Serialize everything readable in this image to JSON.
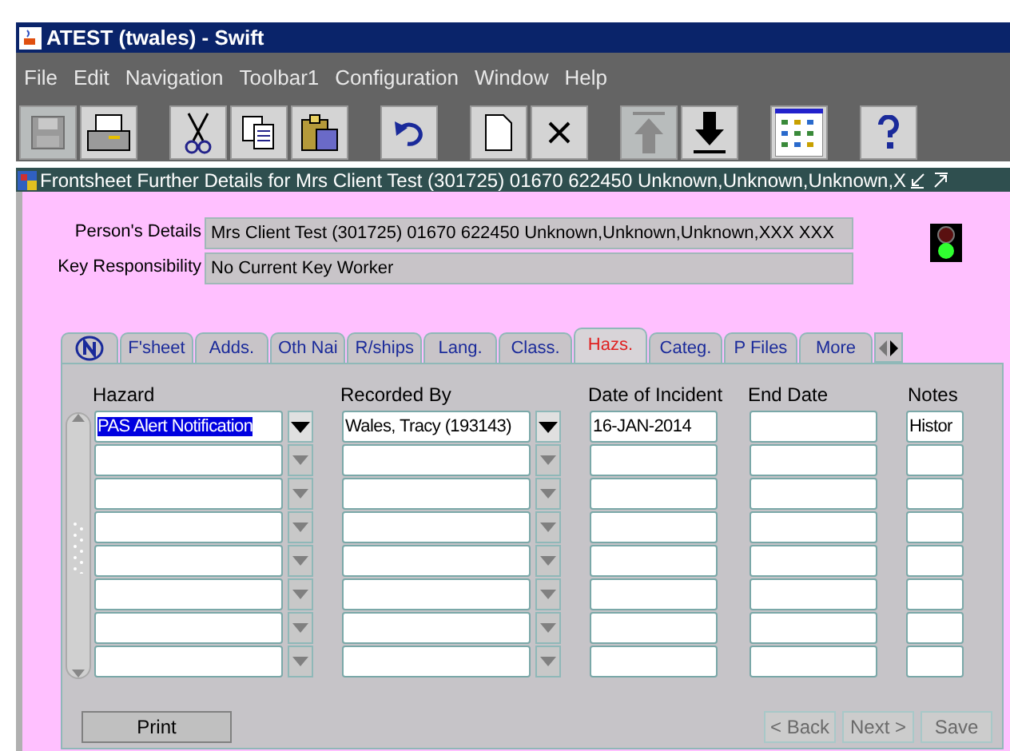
{
  "window": {
    "title": "ATEST (twales) - Swift"
  },
  "menu": [
    {
      "label": "File"
    },
    {
      "label": "Edit"
    },
    {
      "label": "Navigation"
    },
    {
      "label": "Toolbar1"
    },
    {
      "label": "Configuration"
    },
    {
      "label": "Window"
    },
    {
      "label": "Help"
    }
  ],
  "toolbar": [
    {
      "kind": "save",
      "disabled": true
    },
    {
      "kind": "print",
      "disabled": false
    },
    {
      "kind": "gap"
    },
    {
      "kind": "cut",
      "disabled": false
    },
    {
      "kind": "copy",
      "disabled": false
    },
    {
      "kind": "paste",
      "disabled": false
    },
    {
      "kind": "gap"
    },
    {
      "kind": "undo",
      "disabled": false
    },
    {
      "kind": "gap"
    },
    {
      "kind": "new",
      "disabled": false
    },
    {
      "kind": "delete",
      "disabled": false
    },
    {
      "kind": "gap"
    },
    {
      "kind": "up",
      "disabled": true
    },
    {
      "kind": "down",
      "disabled": false
    },
    {
      "kind": "gap"
    },
    {
      "kind": "grid",
      "disabled": false
    },
    {
      "kind": "gap"
    },
    {
      "kind": "help",
      "disabled": false
    }
  ],
  "form": {
    "title": "Frontsheet Further Details for  Mrs Client Test (301725) 01670 622450 Unknown,Unknown,Unknown,X",
    "fields": [
      {
        "label": "Person's Details",
        "value": "Mrs Client Test (301725) 01670 622450 Unknown,Unknown,Unknown,XXX XXX"
      },
      {
        "label": "Key Responsibility",
        "value": "No Current Key Worker"
      }
    ],
    "tabs": [
      {
        "kind": "icon",
        "selected": false
      },
      {
        "kind": "text",
        "label": "F'sheet",
        "selected": false
      },
      {
        "kind": "text",
        "label": "Adds.",
        "selected": false
      },
      {
        "kind": "text",
        "label": "Oth Nai",
        "selected": false
      },
      {
        "kind": "text",
        "label": "R/ships",
        "selected": false
      },
      {
        "kind": "text",
        "label": "Lang.",
        "selected": false
      },
      {
        "kind": "text",
        "label": "Class.",
        "selected": false
      },
      {
        "kind": "text",
        "label": "Hazs.",
        "selected": true
      },
      {
        "kind": "text",
        "label": "Categ.",
        "selected": false
      },
      {
        "kind": "text",
        "label": "P Files",
        "selected": false
      },
      {
        "kind": "text",
        "label": "More",
        "selected": false
      }
    ],
    "table": {
      "columns": [
        "Hazard",
        "Recorded By",
        "Date of Incident",
        "End Date",
        "Notes"
      ],
      "rows": [
        {
          "hazard": "PAS Alert Notification",
          "recorded_by": "Wales, Tracy (193143)",
          "date_of_incident": "16-JAN-2014",
          "notes": "Histor",
          "selected": true
        },
        {
          "selected": false
        },
        {
          "selected": false
        },
        {
          "selected": false
        },
        {
          "selected": false
        },
        {
          "selected": false
        },
        {
          "selected": false
        },
        {
          "selected": false
        }
      ]
    },
    "buttons": [
      {
        "label": "Print",
        "disabled": false
      },
      {
        "label": "< Back",
        "disabled": true
      },
      {
        "label": "Next >",
        "disabled": true
      },
      {
        "label": "Save",
        "disabled": true
      }
    ]
  }
}
